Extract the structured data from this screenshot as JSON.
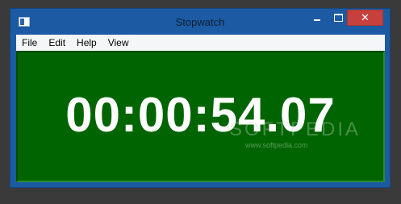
{
  "window": {
    "title": "Stopwatch",
    "app_icon": "window-app-icon",
    "buttons": {
      "minimize_icon": "minimize-icon",
      "maximize_icon": "maximize-icon",
      "close_icon": "close-icon",
      "close_glyph": "✕"
    }
  },
  "menu": {
    "items": [
      {
        "label": "File"
      },
      {
        "label": "Edit"
      },
      {
        "label": "Help"
      },
      {
        "label": "View"
      }
    ]
  },
  "display": {
    "time": "00:00:54.07",
    "watermark": "SOFTPEDIA",
    "watermark_url": "www.softpedia.com"
  },
  "colors": {
    "titlebar": "#1c5aa3",
    "close_button": "#c7413c",
    "display_background": "#006400",
    "time_text": "#ffffff"
  }
}
